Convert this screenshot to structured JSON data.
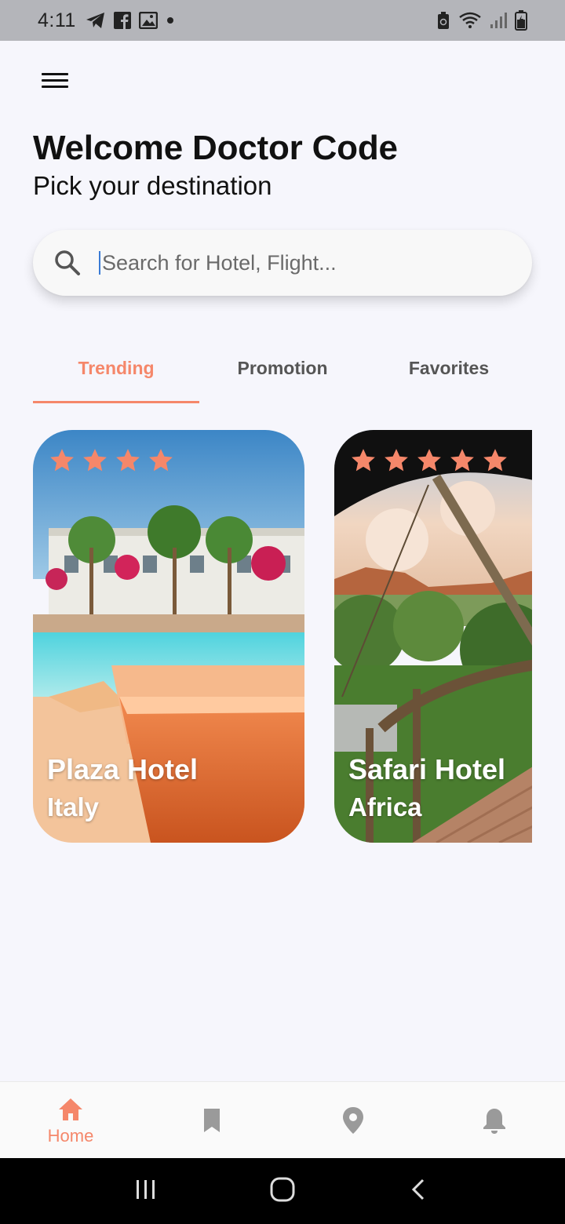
{
  "status_bar": {
    "time": "4:11"
  },
  "header": {
    "title": "Welcome Doctor Code",
    "subtitle": "Pick your destination"
  },
  "search": {
    "placeholder": "Search for Hotel, Flight..."
  },
  "tabs": [
    {
      "label": "Trending",
      "active": true
    },
    {
      "label": "Promotion",
      "active": false
    },
    {
      "label": "Favorites",
      "active": false
    }
  ],
  "cards": [
    {
      "title": "Plaza Hotel",
      "location": "Italy",
      "stars": 4
    },
    {
      "title": "Safari Hotel",
      "location": "Africa",
      "stars": 5
    }
  ],
  "bottom_nav": [
    {
      "icon": "home-icon",
      "label": "Home",
      "active": true
    },
    {
      "icon": "bookmark-icon",
      "label": "",
      "active": false
    },
    {
      "icon": "location-icon",
      "label": "",
      "active": false
    },
    {
      "icon": "bell-icon",
      "label": "",
      "active": false
    }
  ],
  "colors": {
    "accent": "#f5876a",
    "inactive_icon": "#9a9a9a",
    "background": "#f6f6fc"
  }
}
